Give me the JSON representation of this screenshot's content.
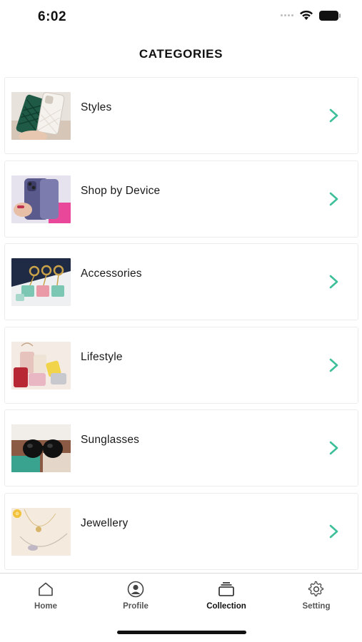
{
  "status_bar": {
    "time": "6:02",
    "icons": [
      "signal-icon",
      "wifi-icon",
      "battery-icon"
    ]
  },
  "header": {
    "title": "CATEGORIES"
  },
  "categories": [
    {
      "label": "Styles",
      "thumbnail": "phone-case-photo",
      "chevron_color": "#3dbf9a"
    },
    {
      "label": "Shop by Device",
      "thumbnail": "hand-holding-phone-photo",
      "chevron_color": "#3dbf9a"
    },
    {
      "label": "Accessories",
      "thumbnail": "keychain-charms-photo",
      "chevron_color": "#3dbf9a"
    },
    {
      "label": "Lifestyle",
      "thumbnail": "bags-photo",
      "chevron_color": "#3dbf9a"
    },
    {
      "label": "Sunglasses",
      "thumbnail": "sunglasses-photo",
      "chevron_color": "#3dbf9a"
    },
    {
      "label": "Jewellery",
      "thumbnail": "necklace-photo",
      "chevron_color": "#3dbf9a"
    }
  ],
  "tab_bar": {
    "active": "collection",
    "tabs": [
      {
        "id": "home",
        "label": "Home",
        "icon": "home-icon"
      },
      {
        "id": "profile",
        "label": "Profile",
        "icon": "profile-icon"
      },
      {
        "id": "collection",
        "label": "Collection",
        "icon": "collection-icon"
      },
      {
        "id": "setting",
        "label": "Setting",
        "icon": "gear-icon"
      }
    ]
  },
  "colors": {
    "accent": "#3dbf9a",
    "text": "#111111",
    "border": "#ececec"
  }
}
